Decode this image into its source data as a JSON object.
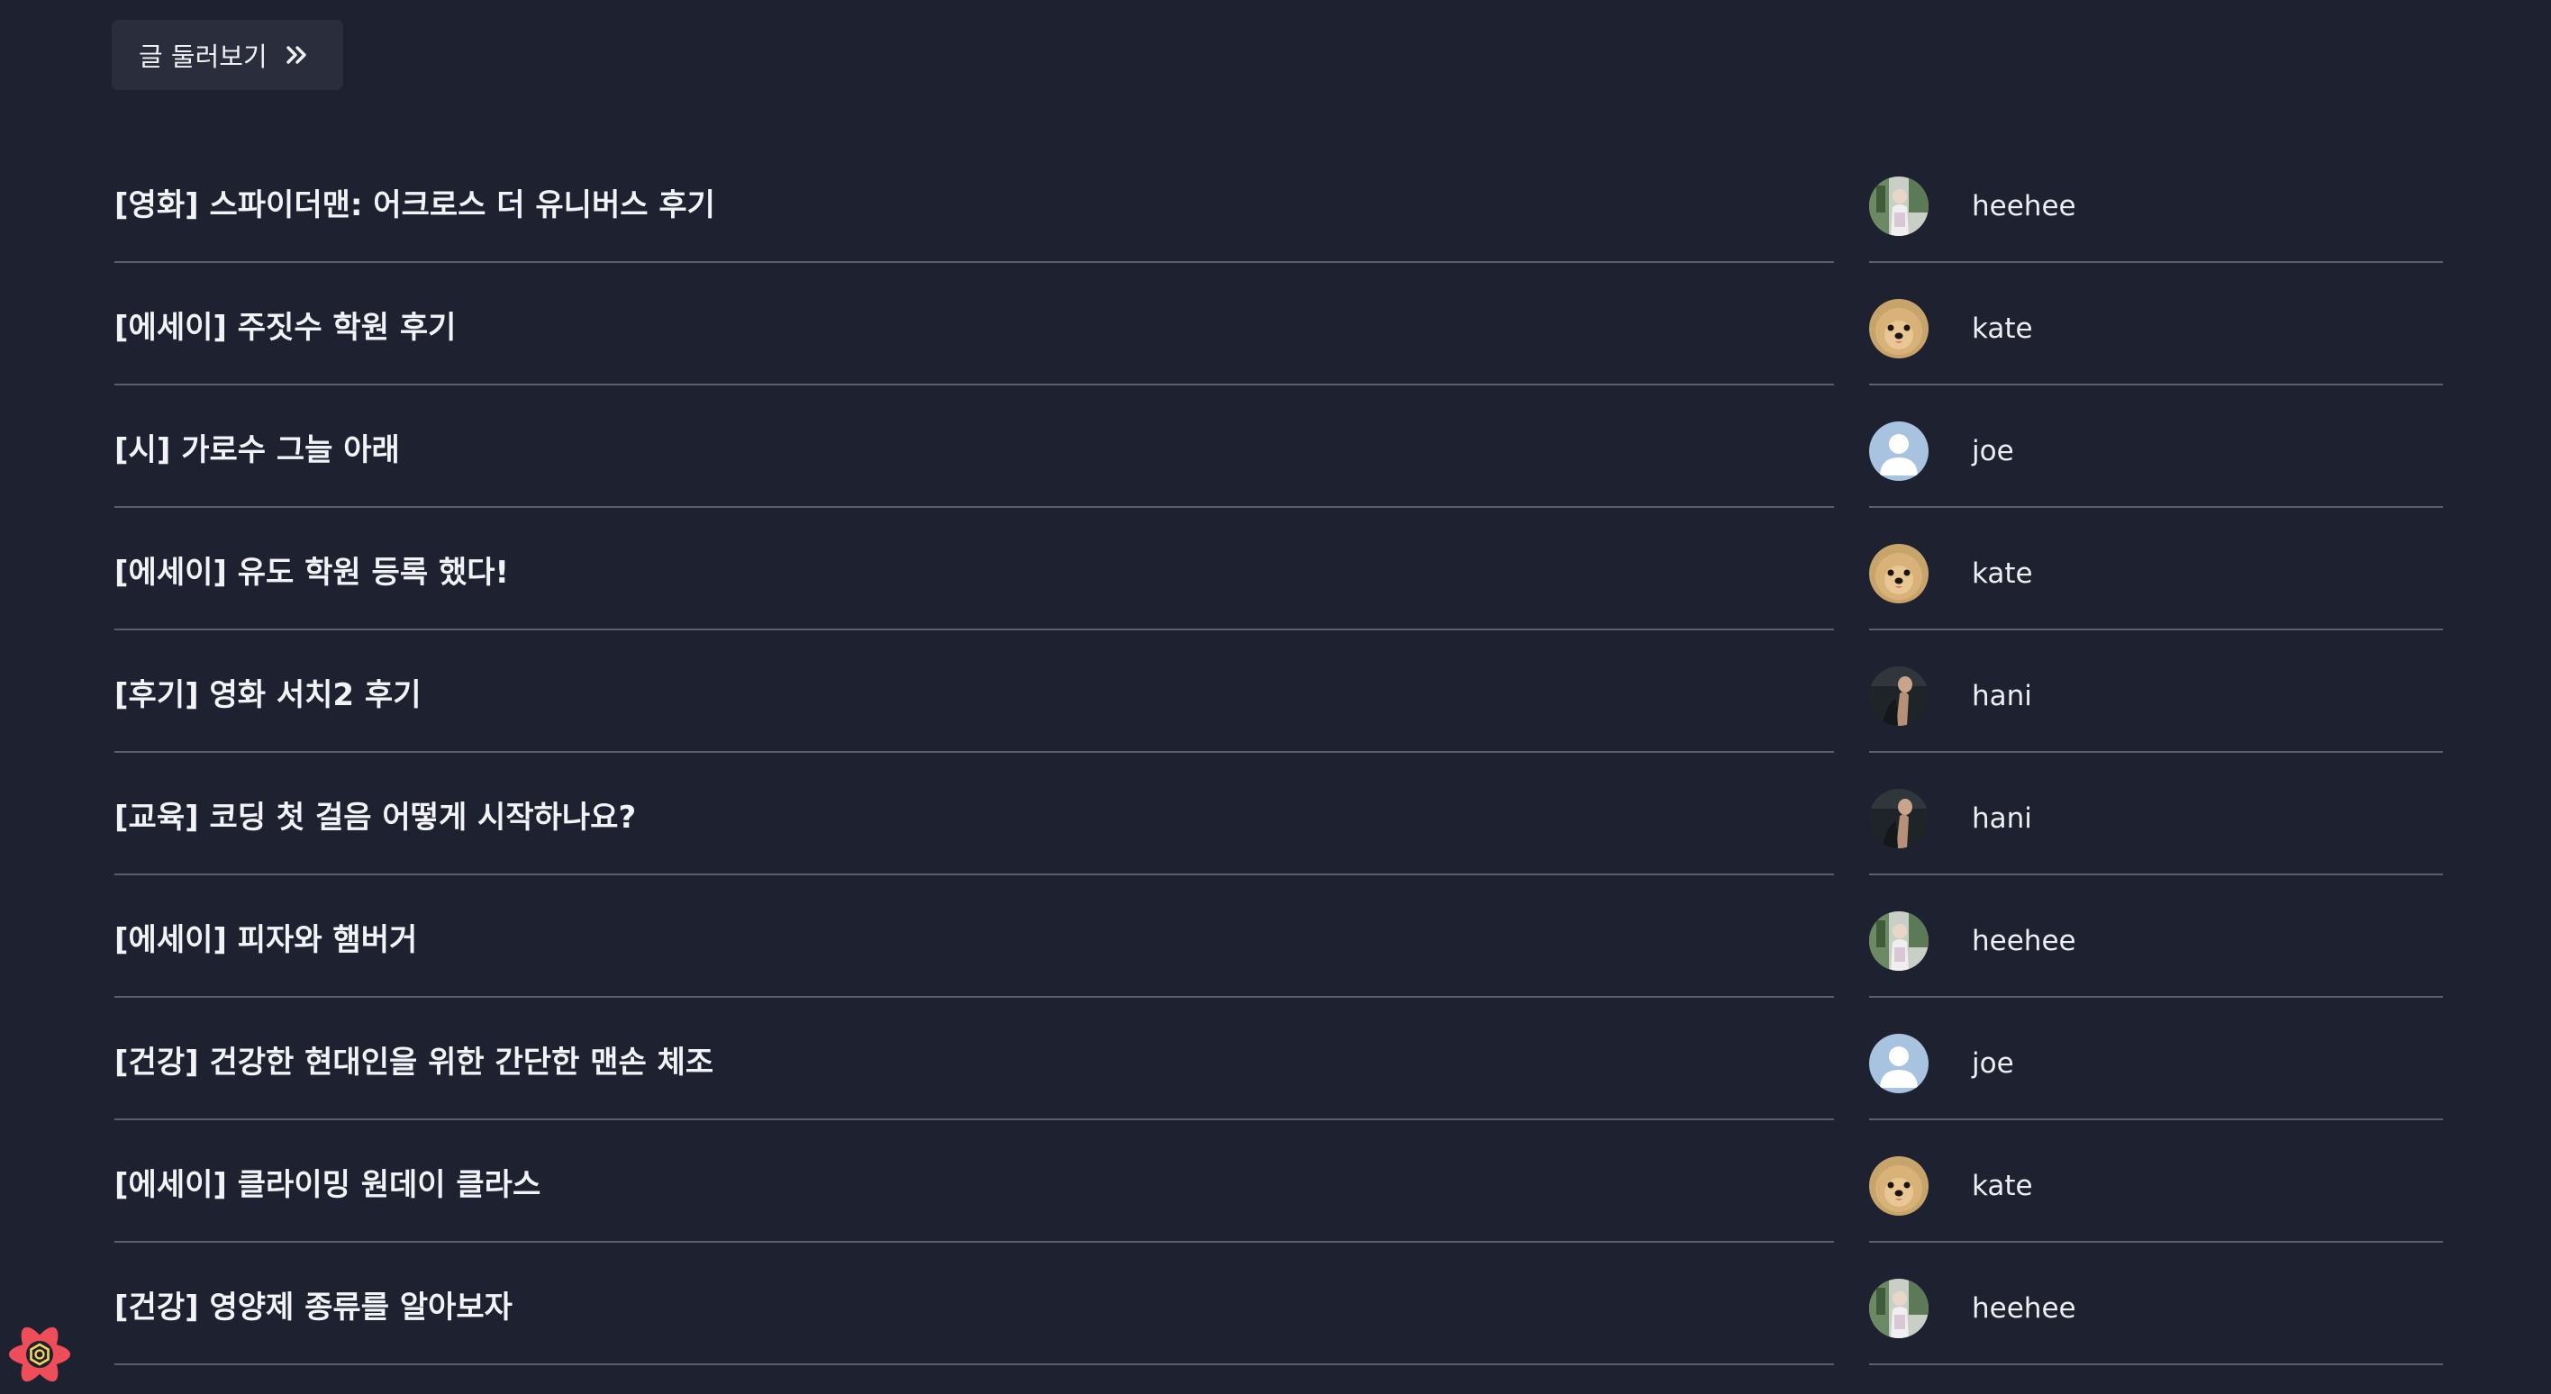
{
  "browse_button": {
    "label": "글 둘러보기",
    "icon": "chevron-double-right-icon"
  },
  "posts": [
    {
      "title": "[영화] 스파이더맨: 어크로스 더 유니버스 후기",
      "author": "heehee",
      "avatar": "photo-person-avatar"
    },
    {
      "title": "[에세이] 주짓수 학원 후기",
      "author": "kate",
      "avatar": "dog-avatar"
    },
    {
      "title": "[시] 가로수 그늘 아래",
      "author": "joe",
      "avatar": "default-user-avatar"
    },
    {
      "title": "[에세이] 유도 학원 등록 했다!",
      "author": "kate",
      "avatar": "dog-avatar"
    },
    {
      "title": "[후기] 영화 서치2 후기",
      "author": "hani",
      "avatar": "dark-photo-avatar"
    },
    {
      "title": "[교육] 코딩 첫 걸음 어떻게 시작하나요?",
      "author": "hani",
      "avatar": "dark-photo-avatar"
    },
    {
      "title": "[에세이] 피자와 햄버거",
      "author": "heehee",
      "avatar": "photo-person-avatar"
    },
    {
      "title": "[건강] 건강한 현대인을 위한 간단한 맨손 체조",
      "author": "joe",
      "avatar": "default-user-avatar"
    },
    {
      "title": "[에세이] 클라이밍 원데이 클라스",
      "author": "kate",
      "avatar": "dog-avatar"
    },
    {
      "title": "[건강] 영양제 종류를 알아보자",
      "author": "heehee",
      "avatar": "photo-person-avatar"
    }
  ],
  "devtools_icon": "react-query-devtools-icon",
  "colors": {
    "background": "#1e2130",
    "button_bg": "#2a2e3c",
    "divider": "#5b5f6c",
    "text": "#f2f3f6",
    "devtools_accent": "#ef4d5a"
  }
}
